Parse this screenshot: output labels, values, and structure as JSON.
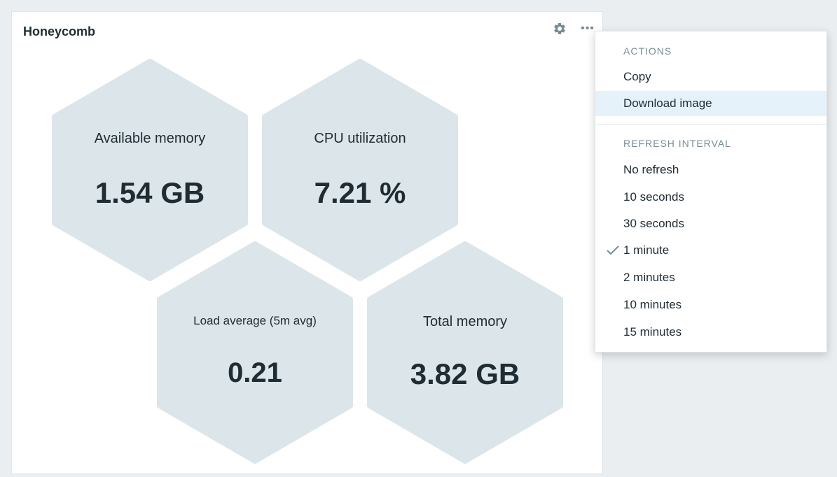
{
  "widget": {
    "title": "Honeycomb",
    "settings_icon": "gear-icon",
    "more_icon": "more-horizontal-icon",
    "more_glyph": "•••"
  },
  "cells": [
    {
      "label": "Available memory",
      "value": "1.54 GB"
    },
    {
      "label": "CPU utilization",
      "value": "7.21 %"
    },
    {
      "label": "Load average (5m avg)",
      "value": "0.21"
    },
    {
      "label": "Total memory",
      "value": "3.82 GB"
    }
  ],
  "menu": {
    "actions_header": "ACTIONS",
    "actions": [
      "Copy",
      "Download image"
    ],
    "highlighted_action": "Download image",
    "refresh_header": "REFRESH INTERVAL",
    "refresh_options": [
      "No refresh",
      "10 seconds",
      "30 seconds",
      "1 minute",
      "2 minutes",
      "10 minutes",
      "15 minutes"
    ],
    "selected_refresh": "1 minute",
    "check_icon": "checkmark-icon"
  },
  "colors": {
    "hex_fill": "#dbe5ea",
    "text": "#1f2c33",
    "muted": "#768d99",
    "highlight": "#e6f2fa",
    "background": "#ebeef0"
  }
}
